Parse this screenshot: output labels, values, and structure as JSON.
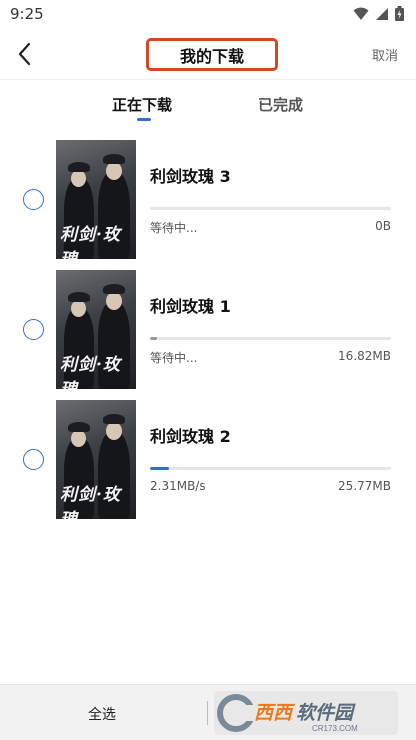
{
  "status_bar": {
    "time": "9:25",
    "icons": [
      "wifi-icon",
      "signal-icon",
      "battery-icon"
    ]
  },
  "header": {
    "title": "我的下载",
    "cancel_label": "取消",
    "back_icon": "chevron-left-icon",
    "title_highlight_color": "#d9451f"
  },
  "tabs": [
    {
      "label": "正在下载",
      "active": true
    },
    {
      "label": "已完成",
      "active": false
    }
  ],
  "accent_color": "#2f6fd6",
  "downloads": [
    {
      "title": "利剑玫瑰 3",
      "status": "等待中...",
      "size": "0B",
      "progress": 0,
      "poster_text": "利剑·玫瑰"
    },
    {
      "title": "利剑玫瑰 1",
      "status": "等待中...",
      "size": "16.82MB",
      "progress": 0.03,
      "poster_text": "利剑·玫瑰"
    },
    {
      "title": "利剑玫瑰 2",
      "status": "2.31MB/s",
      "size": "25.77MB",
      "progress": 0.08,
      "poster_text": "利剑·玫瑰"
    }
  ],
  "bottom_bar": {
    "select_all_label": "全选",
    "watermark_text": "西西软件园",
    "watermark_sub": "CR173.COM"
  }
}
